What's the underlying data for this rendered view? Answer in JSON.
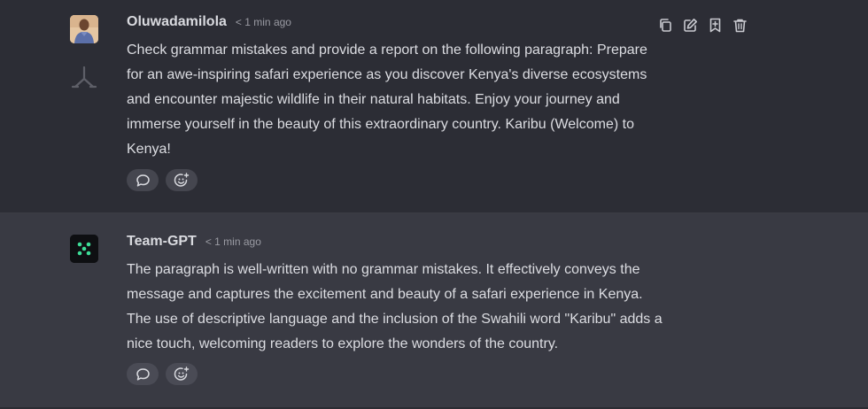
{
  "messages": [
    {
      "author": "Oluwadamilola",
      "time": "< 1 min ago",
      "lines": [
        "Check grammar mistakes and provide a report on the following paragraph: Prepare",
        "for an awe-inspiring safari experience as you discover Kenya's diverse ecosystems",
        "and encounter majestic wildlife in their natural habitats. Enjoy your journey and",
        "immerse yourself in the beauty of this extraordinary country. Karibu (Welcome) to",
        "Kenya!"
      ],
      "avatar_icon": "user-photo-avatar",
      "side_icon": "fork-icon",
      "toolbar_icons": [
        "copy-icon",
        "edit-icon",
        "bookmark-plus-icon",
        "trash-icon"
      ]
    },
    {
      "author": "Team-GPT",
      "time": "< 1 min ago",
      "lines": [
        "The paragraph is well-written with no grammar mistakes. It effectively conveys the",
        "message and captures the excitement and beauty of a safari experience in Kenya.",
        "The use of descriptive language and the inclusion of the Swahili word \"Karibu\" adds a",
        "nice touch, welcoming readers to explore the wonders of the country."
      ],
      "avatar_icon": "team-gpt-logo",
      "accent": "#3ddc97"
    }
  ],
  "reaction_icons": [
    "comment-icon",
    "add-reaction-icon"
  ],
  "colors": {
    "user_bg": "#2c2d35",
    "ai_bg": "#393a43",
    "text": "#dcdde2",
    "muted": "#9a9ba3"
  }
}
